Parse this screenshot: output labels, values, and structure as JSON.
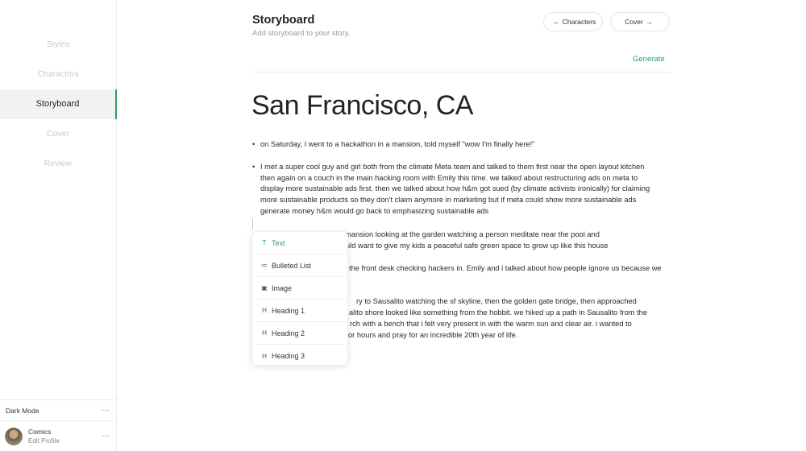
{
  "sidebar": {
    "items": [
      {
        "label": "Styles"
      },
      {
        "label": "Characters"
      },
      {
        "label": "Storyboard"
      },
      {
        "label": "Cover"
      },
      {
        "label": "Review"
      }
    ],
    "dark_mode_label": "Dark Mode",
    "more_symbol": "···",
    "profile": {
      "name": "Comics",
      "edit_label": "Edit Profile"
    }
  },
  "header": {
    "title": "Storyboard",
    "subtitle": "Add storyboard to your story.",
    "back_label": "Characters",
    "back_arrow": "←",
    "next_label": "Cover",
    "next_arrow": "→",
    "generate_label": "Generate"
  },
  "document": {
    "title": "San Francisco, CA",
    "p1": "on Saturday, I went to a hackathon in a mansion, told myself \"wow I'm finally here!\"",
    "p2_lines": [
      "I met a super cool guy and girl both from the climate Meta team and talked to them first near the open layout kitchen",
      "then again on a couch in the main hacking room with Emily this time. we talked about restructuring ads on meta to",
      "display more sustainable ads first. then we talked about how h&m got sued (by climate activists ironically) for claiming",
      "more sustainable products so they don't claim anymore in marketing but if meta could show more sustainable ads",
      "generate money h&m would go back to emphasizing sustainable ads"
    ],
    "fragments": [
      "outside the mansion looking at the garden watching a person meditate near the pool and",
      "uld want to give my kids a peaceful safe green space to grow up like this house",
      "the front desk checking hackers in. Emily and i talked about how people ignore us because we",
      "ry to Sausalito watching the sf skyline, then the golden gate bridge, then approached",
      "alito shore looked like something from the hobbit. we hiked up a path in Sausalito from the",
      "rch with a bench that i felt very present in with the warm sun and clear air. i wanted to",
      "or hours and pray for an incredible 20th year of life."
    ]
  },
  "slash_menu": {
    "items": [
      {
        "label": "Text",
        "icon": "text-icon",
        "glyph": "T"
      },
      {
        "label": "Bulleted List",
        "icon": "list-icon",
        "glyph": "≔"
      },
      {
        "label": "Image",
        "icon": "image-icon",
        "glyph": "▣"
      },
      {
        "label": "Heading 1",
        "icon": "heading-icon",
        "glyph": "H"
      },
      {
        "label": "Heading 2",
        "icon": "heading-icon",
        "glyph": "H"
      },
      {
        "label": "Heading 3",
        "icon": "heading-icon",
        "glyph": "H"
      }
    ]
  },
  "colors": {
    "accent": "#2e9e5f",
    "muted_nav": "#c9c9c9"
  }
}
